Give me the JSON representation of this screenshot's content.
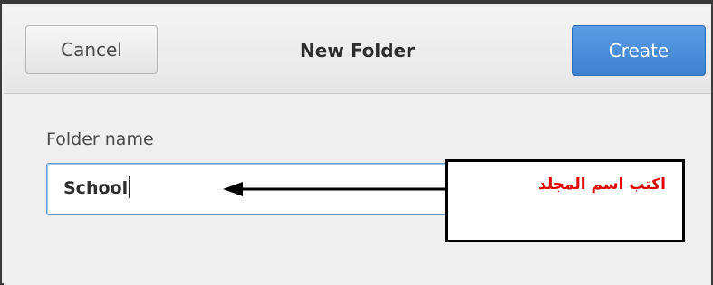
{
  "dialog": {
    "title": "New Folder",
    "cancel_label": "Cancel",
    "create_label": "Create"
  },
  "form": {
    "field_label": "Folder name",
    "field_value": "School"
  },
  "annotation": {
    "text": "اكتب اسم  المجلد",
    "text_color": "#e00000"
  },
  "colors": {
    "accent": "#4a90d9"
  }
}
